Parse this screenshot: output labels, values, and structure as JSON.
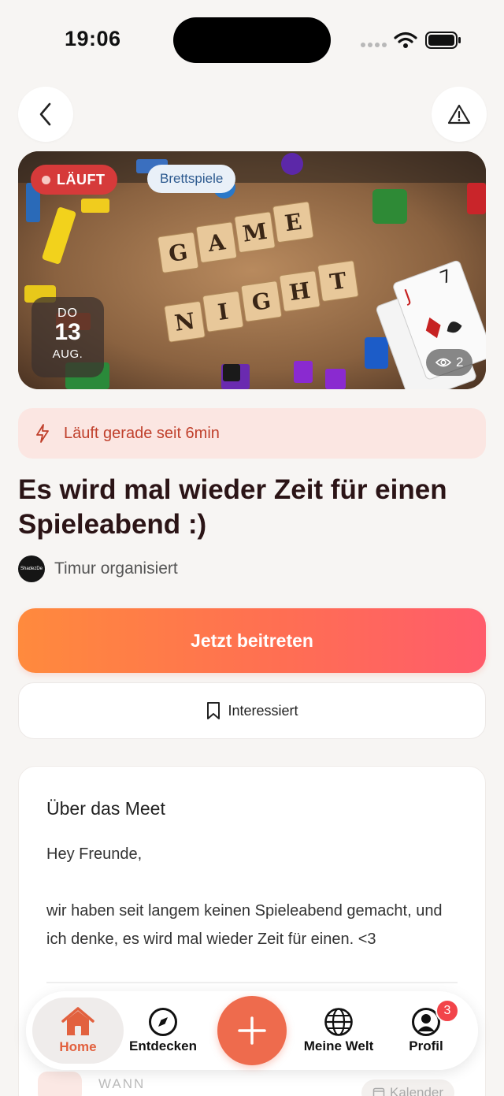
{
  "status_bar": {
    "time": "19:06"
  },
  "hero": {
    "status_badge": "LÄUFT",
    "category": "Brettspiele",
    "date": {
      "weekday": "DO",
      "day": "13",
      "month": "AUG."
    },
    "view_count": "2",
    "image_text": [
      "GAME",
      "NIGHT"
    ]
  },
  "live_banner": {
    "text": "Läuft gerade seit 6min"
  },
  "event": {
    "title": "Es wird mal wieder Zeit für einen Spieleabend :)",
    "organizer_avatar_text": "ShadezDe",
    "organizer": "Timur organisiert"
  },
  "actions": {
    "join_label": "Jetzt beitreten",
    "interested_label": "Interessiert"
  },
  "about": {
    "title": "Über das Meet",
    "greeting": "Hey Freunde,",
    "body": "wir haben seit langem keinen Spieleabend gemacht, und ich denke, es wird mal wieder Zeit für einen. <3"
  },
  "details": {
    "when_label": "WANN",
    "calendar_label": "Kalender"
  },
  "tabbar": {
    "home": "Home",
    "explore": "Entdecken",
    "world": "Meine Welt",
    "profile": "Profil",
    "profile_badge": "3"
  },
  "colors": {
    "accent": "#ee6b4d",
    "live_red": "#d63a3a",
    "gradient_start": "#ff8a3d",
    "gradient_end": "#ff5c6b"
  }
}
